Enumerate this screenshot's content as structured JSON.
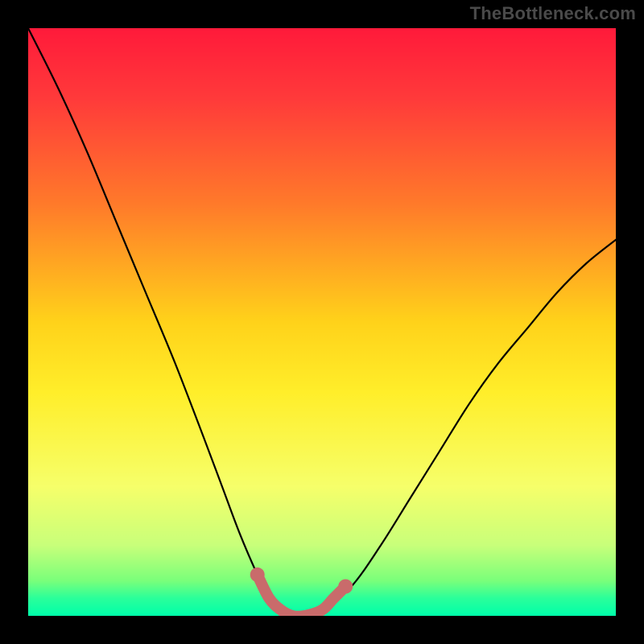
{
  "watermark": "TheBottleneck.com",
  "chart_data": {
    "type": "line",
    "title": "",
    "xlabel": "",
    "ylabel": "",
    "xlim": [
      0,
      100
    ],
    "ylim": [
      0,
      100
    ],
    "gradient_stops": [
      {
        "offset": 0,
        "color": "#ff1a3a"
      },
      {
        "offset": 0.12,
        "color": "#ff3a3a"
      },
      {
        "offset": 0.3,
        "color": "#ff7a2a"
      },
      {
        "offset": 0.5,
        "color": "#ffd21a"
      },
      {
        "offset": 0.62,
        "color": "#ffee2a"
      },
      {
        "offset": 0.78,
        "color": "#f6ff6a"
      },
      {
        "offset": 0.88,
        "color": "#c8ff7a"
      },
      {
        "offset": 0.94,
        "color": "#7aff7a"
      },
      {
        "offset": 0.97,
        "color": "#2aff9a"
      },
      {
        "offset": 1.0,
        "color": "#00ffaa"
      }
    ],
    "series": [
      {
        "name": "bottleneck-curve",
        "x": [
          0,
          5,
          10,
          15,
          20,
          25,
          30,
          33,
          36,
          39,
          41,
          43,
          45,
          47,
          50,
          55,
          60,
          65,
          70,
          75,
          80,
          85,
          90,
          95,
          100
        ],
        "y": [
          100,
          90,
          79,
          67,
          55,
          43,
          30,
          22,
          14,
          7,
          3,
          1,
          0,
          0,
          1,
          5,
          12,
          20,
          28,
          36,
          43,
          49,
          55,
          60,
          64
        ]
      }
    ],
    "highlight": {
      "name": "flat-minimum",
      "color": "#c96b6b",
      "points": [
        {
          "x": 39,
          "y": 7
        },
        {
          "x": 41,
          "y": 3
        },
        {
          "x": 43,
          "y": 1
        },
        {
          "x": 45,
          "y": 0
        },
        {
          "x": 47,
          "y": 0
        },
        {
          "x": 50,
          "y": 1
        },
        {
          "x": 52,
          "y": 3
        },
        {
          "x": 54,
          "y": 5
        }
      ]
    }
  }
}
